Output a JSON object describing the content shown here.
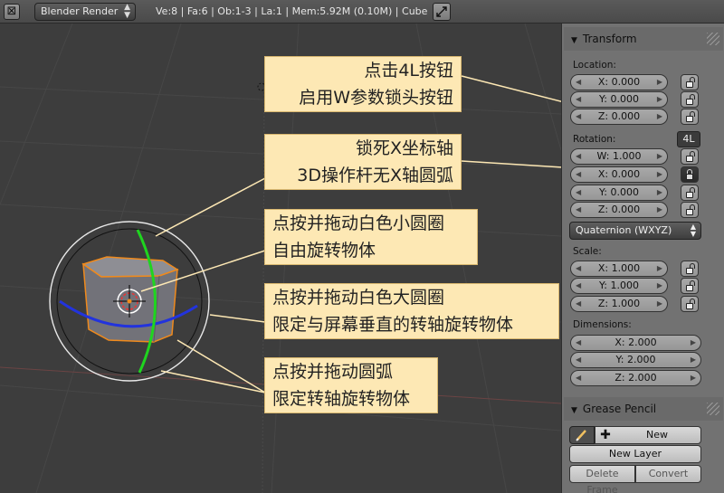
{
  "header": {
    "editor_icon": "editor-type-icon",
    "render_engine": "Blender Render",
    "stats": "Ve:8 | Fa:6 | Ob:1-3 | La:1 | Mem:5.92M (0.10M) | Cube",
    "fullscreen_icon": "fullscreen-icon"
  },
  "callouts": [
    {
      "line1": "点击4L按钮",
      "line2": "启用W参数锁头按钮"
    },
    {
      "line1": "锁死X坐标轴",
      "line2": "3D操作杆无X轴圆弧"
    },
    {
      "line1": "点按并拖动白色小圆圈",
      "line2": "自由旋转物体"
    },
    {
      "line1": "点按并拖动白色大圆圈",
      "line2": "限定与屏幕垂直的转轴旋转物体"
    },
    {
      "line1": "点按并拖动圆弧",
      "line2": "限定转轴旋转物体"
    }
  ],
  "panel": {
    "transform": {
      "title": "Transform",
      "location_label": "Location:",
      "location": [
        "X: 0.000",
        "Y: 0.000",
        "Z: 0.000"
      ],
      "rotation_label": "Rotation:",
      "fourl_label": "4L",
      "rotation": [
        "W: 1.000",
        "X: 0.000",
        "Y: 0.000",
        "Z: 0.000"
      ],
      "rotation_mode": "Quaternion (WXYZ)",
      "scale_label": "Scale:",
      "scale": [
        "X: 1.000",
        "Y: 1.000",
        "Z: 1.000"
      ],
      "dimensions_label": "Dimensions:",
      "dimensions": [
        "X: 2.000",
        "Y: 2.000",
        "Z: 2.000"
      ]
    },
    "grease_pencil": {
      "title": "Grease Pencil",
      "new_label": "New",
      "new_layer_label": "New Layer",
      "delete_frame_label": "Delete Frame",
      "convert_label": "Convert"
    }
  },
  "colors": {
    "callout_bg": "#fde8b4",
    "viewport_bg": "#3d3d3d",
    "gizmo_green": "#1fd51f",
    "gizmo_blue": "#2233dd",
    "cube_outline": "#f08a1c"
  }
}
